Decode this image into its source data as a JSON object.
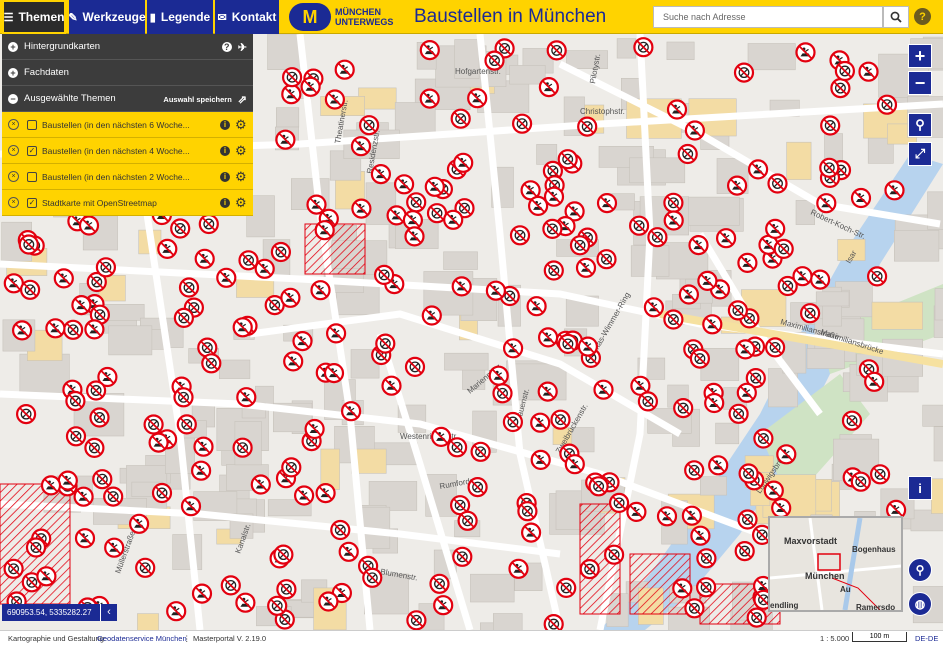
{
  "header": {
    "menu": [
      {
        "label": "Themen",
        "icon": "list-icon"
      },
      {
        "label": "Werkzeuge",
        "icon": "wrench-icon"
      },
      {
        "label": "Legende",
        "icon": "book-icon"
      },
      {
        "label": "Kontakt",
        "icon": "envelope-icon"
      }
    ],
    "logo_mark": "M",
    "logo_line1": "MÜNCHEN",
    "logo_line2": "UNTERWEGS",
    "title": "Baustellen in München",
    "search_placeholder": "Suche nach Adresse"
  },
  "panel": {
    "sections": [
      {
        "label": "Hintergrundkarten",
        "sign": "+"
      },
      {
        "label": "Fachdaten",
        "sign": "+"
      },
      {
        "label": "Ausgewählte Themen",
        "sign": "−",
        "action": "Auswahl speichern"
      }
    ],
    "layers": [
      {
        "label": "Baustellen (in den nächsten 6 Woche...",
        "checked": false
      },
      {
        "label": "Baustellen (in den nächsten 4 Woche...",
        "checked": true
      },
      {
        "label": "Baustellen (in den nächsten 2 Woche...",
        "checked": false
      },
      {
        "label": "Stadtkarte mit OpenStreetmap",
        "checked": true
      }
    ]
  },
  "map": {
    "street_labels": [
      "Hohenzollern",
      "Hofgartenstr.",
      "Theatinerstr.",
      "Residenzstr.",
      "Maximilianstraße",
      "Marienplatz",
      "Westenriederstr.",
      "Rumfordstr.",
      "Blumenstr.",
      "Müllerstraße",
      "Frauenstr.",
      "Zweibrückenstr.",
      "Robert-Koch-Str.",
      "Maximiliansbrücke",
      "Thomas-Wimmer-Ring",
      "Pilotystr.",
      "Christophstr.",
      "Kanalstr.",
      "Ludwigsbrücke",
      "Isar"
    ],
    "overview": {
      "labels": [
        "Maxvorstadt",
        "Bogenhaus",
        "München",
        "Au",
        "endling",
        "Ramersdo"
      ]
    }
  },
  "coordinates": "690953.54, 5335282.27",
  "footer": {
    "credit_prefix": "Kartographie und Gestaltung:",
    "credit_link": "Geodatenservice München",
    "version": "Masterportal V. 2.19.0",
    "scale": "1 : 5.000",
    "scale_bar": "100 m",
    "language": "DE-DE"
  },
  "colors": {
    "brand_blue": "#1b2a94",
    "brand_yellow": "#ffd300",
    "marker_red": "#e3000f"
  }
}
